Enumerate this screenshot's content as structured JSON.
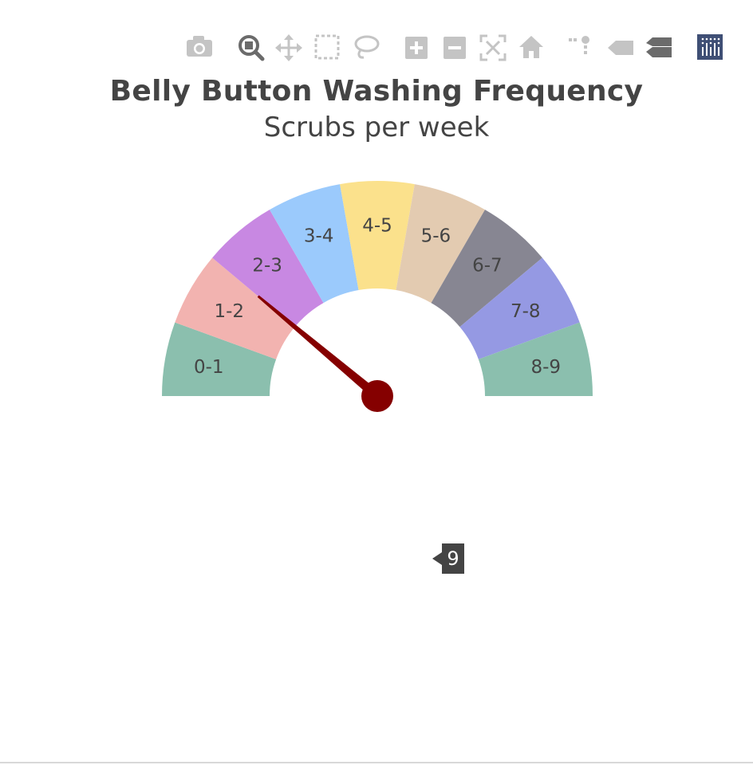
{
  "modebar": {
    "buttons": [
      {
        "icon": "camera-icon",
        "title": "Download plot as a png"
      },
      {
        "icon": "zoom-icon",
        "title": "Zoom"
      },
      {
        "icon": "pan-icon",
        "title": "Pan"
      },
      {
        "icon": "box-select-icon",
        "title": "Box Select"
      },
      {
        "icon": "lasso-select-icon",
        "title": "Lasso Select"
      },
      {
        "icon": "zoom-in-icon",
        "title": "Zoom in"
      },
      {
        "icon": "zoom-out-icon",
        "title": "Zoom out"
      },
      {
        "icon": "autoscale-icon",
        "title": "Autoscale"
      },
      {
        "icon": "reset-axes-icon",
        "title": "Reset axes"
      },
      {
        "icon": "spike-lines-icon",
        "title": "Toggle Spike Lines"
      },
      {
        "icon": "hover-closest-icon",
        "title": "Show closest data on hover"
      },
      {
        "icon": "hover-compare-icon",
        "title": "Compare data on hover"
      },
      {
        "icon": "plotly-logo-icon",
        "title": "Produced with Plotly"
      }
    ],
    "colors": {
      "inactive": "#c4c4c4",
      "active": "#6b6b6b",
      "logo": "#3f4f75"
    }
  },
  "chart_data": {
    "type": "gauge",
    "title": "Belly Button Washing Frequency",
    "subtitle": "Scrubs per week",
    "range": [
      0,
      9
    ],
    "segments": [
      {
        "label": "0-1",
        "from": 0,
        "to": 1,
        "color": "#8bbfae"
      },
      {
        "label": "1-2",
        "from": 1,
        "to": 2,
        "color": "#f2b3b0"
      },
      {
        "label": "2-3",
        "from": 2,
        "to": 3,
        "color": "#c888e2"
      },
      {
        "label": "3-4",
        "from": 3,
        "to": 4,
        "color": "#9bcafc"
      },
      {
        "label": "4-5",
        "from": 4,
        "to": 5,
        "color": "#fbe18c"
      },
      {
        "label": "5-6",
        "from": 5,
        "to": 6,
        "color": "#e3cbb1"
      },
      {
        "label": "6-7",
        "from": 6,
        "to": 7,
        "color": "#878692"
      },
      {
        "label": "7-8",
        "from": 7,
        "to": 8,
        "color": "#9599e3"
      },
      {
        "label": "8-9",
        "from": 8,
        "to": 9,
        "color": "#8bbfae"
      }
    ],
    "needle_value": 2,
    "needle_color": "#850000",
    "hover_label": "9"
  }
}
